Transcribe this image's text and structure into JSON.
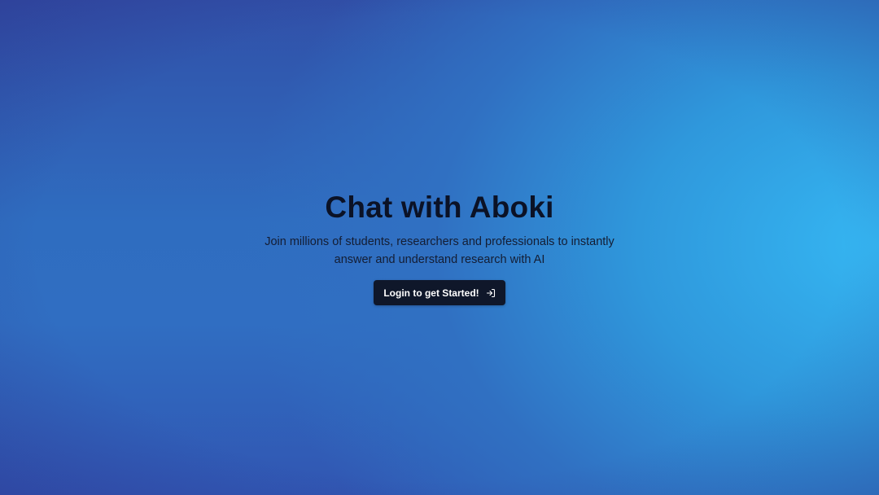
{
  "hero": {
    "title": "Chat with Aboki",
    "subtitle": "Join millions of students, researchers and professionals to instantly answer and understand research with AI",
    "cta_label": "Login to get Started!",
    "cta_icon": "log-in-icon"
  },
  "colors": {
    "background_light": "#35b6f2",
    "background_dark": "#3150a8",
    "button_bg": "#0f172a",
    "button_text": "#ffffff",
    "title_text": "#0b1226"
  }
}
